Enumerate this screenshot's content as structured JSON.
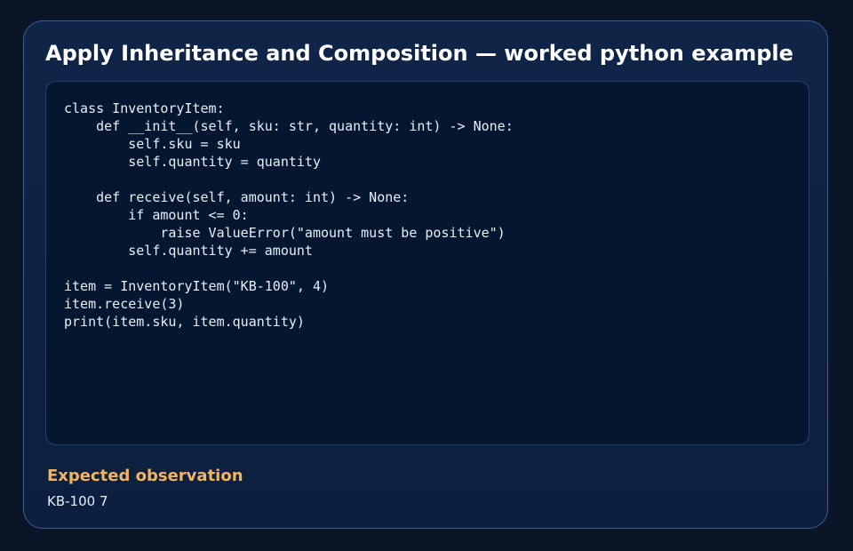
{
  "card": {
    "title": "Apply Inheritance and Composition — worked python example",
    "code": "class InventoryItem:\n    def __init__(self, sku: str, quantity: int) -> None:\n        self.sku = sku\n        self.quantity = quantity\n\n    def receive(self, amount: int) -> None:\n        if amount <= 0:\n            raise ValueError(\"amount must be positive\")\n        self.quantity += amount\n\nitem = InventoryItem(\"KB-100\", 4)\nitem.receive(3)\nprint(item.sku, item.quantity)",
    "observation_label": "Expected observation",
    "observation_value": "KB-100 7"
  },
  "colors": {
    "background": "#0a1628",
    "card": "#0f2548",
    "card_border": "#3d5f8f",
    "code_panel": "#051730",
    "code_text": "#e6eef8",
    "accent": "#f2b45c"
  }
}
